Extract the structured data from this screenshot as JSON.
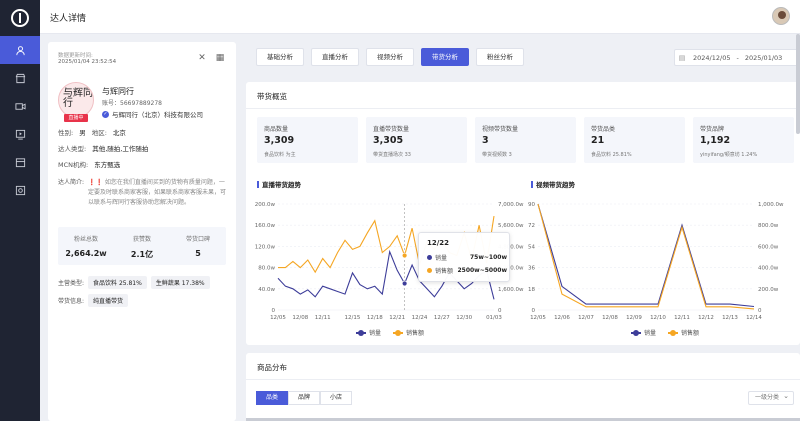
{
  "header": {
    "title": "达人详情"
  },
  "sidebar": {
    "icons": [
      "user-icon",
      "store-icon",
      "video-icon",
      "live-icon",
      "shop-icon",
      "data-icon"
    ]
  },
  "profile": {
    "update_label": "数据更新时间:",
    "update_time": "2025/01/04 23:52:54",
    "name": "与辉同行",
    "account": "账号：56697889278",
    "company": "与辉同行（北京）科技有限公司",
    "live_badge": "直播中",
    "avatar_mark": "与辉同行",
    "gender_label": "性别:",
    "gender": "男",
    "region_label": "地区:",
    "region": "北京",
    "type_label": "达人类型:",
    "type": "其他,随拍,工作随拍",
    "mcn_label": "MCN机构:",
    "mcn": "东方甄选",
    "intro_label": "达人简介:",
    "intro_warn": "❗❗",
    "intro_text": "如您在我们直播间买到的货物有质量问题，一定要及时联系商家客服，如果联系商家客服未果，可以联系与辉同行客服协助您解决问题。",
    "stats": [
      {
        "label": "粉丝总数",
        "value": "2,664.2w"
      },
      {
        "label": "获赞数",
        "value": "2.1亿"
      },
      {
        "label": "带货口碑",
        "value": "5"
      }
    ],
    "main_cat_label": "主营类型:",
    "main_cats": [
      "食品饮料 25.81%",
      "生鲜蔬果 17.38%"
    ],
    "info_label": "带货信息:",
    "info_value": "纯直播带货"
  },
  "tabs": [
    {
      "label": "基础分析",
      "active": false
    },
    {
      "label": "直播分析",
      "active": false
    },
    {
      "label": "视频分析",
      "active": false
    },
    {
      "label": "带货分析",
      "active": true
    },
    {
      "label": "粉丝分析",
      "active": false
    }
  ],
  "date_range": {
    "start": "2024/12/05",
    "sep": "-",
    "end": "2025/01/03"
  },
  "overview": {
    "title": "带货概览",
    "cards": [
      {
        "label": "商品数量",
        "value": "3,309",
        "sub": "食品饮料 为主"
      },
      {
        "label": "直播带货数量",
        "value": "3,305",
        "sub": "带货直播场次 33"
      },
      {
        "label": "视频带货数量",
        "value": "3",
        "sub": "带货视频数 3"
      },
      {
        "label": "带货品类",
        "value": "21",
        "sub": "食品饮料 25.81%"
      },
      {
        "label": "带货品牌",
        "value": "1,192",
        "sub": "yinyifang/顿意坊 1.24%"
      }
    ]
  },
  "chart_data": [
    {
      "type": "line",
      "title": "直播带货趋势",
      "x": [
        "12/05",
        "12/06",
        "12/07",
        "12/08",
        "12/09",
        "12/10",
        "12/11",
        "12/12",
        "12/13",
        "12/14",
        "12/15",
        "12/16",
        "12/17",
        "12/18",
        "12/19",
        "12/20",
        "12/21",
        "12/22",
        "12/23",
        "12/24",
        "12/25",
        "12/26",
        "12/27",
        "12/28",
        "12/29",
        "12/30",
        "12/31",
        "01/01",
        "01/02",
        "01/03"
      ],
      "x_ticks": [
        "12/05",
        "12/08",
        "12/11",
        "12/15",
        "12/18",
        "12/21",
        "12/24",
        "12/27",
        "12/30",
        "01/03"
      ],
      "y_left_ticks": [
        "0",
        "40.0w",
        "80.0w",
        "120.0w",
        "160.0w",
        "200.0w"
      ],
      "y_right_ticks": [
        "0",
        "1,600.0w",
        "3,200.0w",
        "4,800.0w",
        "5,600.0w",
        "7,000.0w"
      ],
      "ylim_left": [
        0,
        200
      ],
      "ylim_right": [
        0,
        7000
      ],
      "series": [
        {
          "name": "销量",
          "color": "#3d3d99",
          "axis": "left",
          "values": [
            60,
            45,
            40,
            30,
            38,
            25,
            45,
            40,
            35,
            30,
            70,
            48,
            40,
            45,
            30,
            110,
            75,
            50,
            85,
            55,
            40,
            25,
            45,
            70,
            55,
            40,
            50,
            65,
            75,
            20
          ]
        },
        {
          "name": "销售额",
          "color": "#f5a623",
          "axis": "right",
          "values": [
            2800,
            2800,
            3200,
            2800,
            3300,
            2500,
            3400,
            2800,
            3800,
            4600,
            4000,
            4200,
            5100,
            5900,
            3800,
            4200,
            4900,
            3600,
            5400,
            3000,
            4500,
            4000,
            4600,
            3800,
            3600,
            5100,
            3300,
            5600,
            3100,
            6200
          ]
        }
      ],
      "tooltip": {
        "date": "12/22",
        "rows": [
          {
            "name": "销量",
            "value": "75w~100w"
          },
          {
            "name": "销售额",
            "value": "2500w~5000w"
          }
        ]
      }
    },
    {
      "type": "line",
      "title": "视频带货趋势",
      "x": [
        "12/05",
        "12/06",
        "12/07",
        "12/08",
        "12/09",
        "12/10",
        "12/11",
        "12/12",
        "12/13",
        "12/14"
      ],
      "x_ticks": [
        "12/05",
        "12/06",
        "12/07",
        "12/08",
        "12/09",
        "12/10",
        "12/11",
        "12/12",
        "12/13",
        "12/14"
      ],
      "y_left_ticks": [
        "0",
        "18",
        "36",
        "54",
        "72",
        "90"
      ],
      "y_right_ticks": [
        "0",
        "200.0w",
        "400.0w",
        "600.0w",
        "800.0w",
        "1,000.0w"
      ],
      "ylim_left": [
        0,
        90
      ],
      "ylim_right": [
        0,
        1000
      ],
      "series": [
        {
          "name": "销量",
          "color": "#3d3d99",
          "axis": "left",
          "values": [
            90,
            20,
            5,
            5,
            5,
            5,
            72,
            5,
            5,
            3
          ]
        },
        {
          "name": "销售额",
          "color": "#f5a623",
          "axis": "right",
          "values": [
            1000,
            150,
            30,
            30,
            30,
            30,
            780,
            30,
            30,
            10
          ]
        }
      ]
    }
  ],
  "legend": {
    "s1": "销量",
    "s2": "销售额"
  },
  "distribution": {
    "title": "商品分布",
    "subtabs": [
      {
        "label": "品类",
        "active": true
      },
      {
        "label": "品牌",
        "active": false
      },
      {
        "label": "小店",
        "active": false
      }
    ],
    "select": "一级分类"
  }
}
